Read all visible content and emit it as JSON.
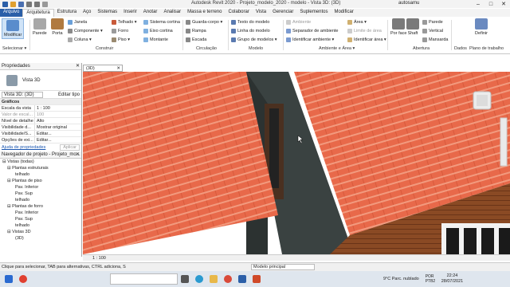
{
  "titlebar": {
    "title": "Autodesk Revit 2020 - Projeto_modelo_2020 - modelo - Vista 3D: (3D)",
    "user": "autosamu"
  },
  "tabs": [
    "Arquivo",
    "Arquitetura",
    "Estrutura",
    "Aço",
    "Sistemas",
    "Inserir",
    "Anotar",
    "Analisar",
    "Massa e terreno",
    "Colaborar",
    "Vista",
    "Gerenciar",
    "Suplementos",
    "Modificar"
  ],
  "ribbon": {
    "modificar": "Modificar",
    "selecionar": "Selecionar ▾",
    "construir": {
      "parede": "Parede",
      "porta": "Porta",
      "janela": "Janela",
      "componente": "Componente ▾",
      "coluna": "Coluna ▾",
      "telhado": "Telhado ▾",
      "forro": "Forro",
      "piso": "Piso ▾",
      "sistema_cortina": "Sistema cortina",
      "eixo_cortina": "Eixo cortina",
      "montante": "Montante",
      "label": "Construir"
    },
    "circulacao": {
      "guarda_corpo": "Guarda-corpo ▾",
      "rampa": "Rampa",
      "escada": "Escada",
      "label": "Circulação"
    },
    "modelo": {
      "texto": "Texto do modelo",
      "linha": "Linha do modelo",
      "grupo": "Grupo de modelos ▾",
      "label": "Modelo"
    },
    "ambiente": {
      "ambiente": "Ambiente",
      "separador": "Separador de ambiente",
      "identificar": "Identificar ambiente ▾",
      "area": "Área ▾",
      "limite": "Limite de área",
      "identificar_area": "Identificar área ▾",
      "label": "Ambiente e Área ▾"
    },
    "abertura": {
      "por_face": "Por face",
      "shaft": "Shaft",
      "parede": "Parede",
      "vertical": "Vertical",
      "mansarda": "Mansarda",
      "label": "Abertura"
    },
    "dados": {
      "label": "Dados"
    },
    "plano": {
      "definir": "Definir",
      "label": "Plano de trabalho"
    }
  },
  "properties": {
    "header": "Propriedades",
    "type": "Vista 3D",
    "selector": "Vista 3D: (3D)",
    "edit_type": "Editar tipo",
    "section": "Gráficos",
    "rows": [
      {
        "k": "Escala da vista",
        "v": "1 : 100"
      },
      {
        "k": "Valor de escal...",
        "v": "100"
      },
      {
        "k": "Nível de detalhe",
        "v": "Alto"
      },
      {
        "k": "Visibilidade d...",
        "v": "Mostrar original"
      },
      {
        "k": "Visibilidade/S...",
        "v": "Editar..."
      },
      {
        "k": "Opções de exi...",
        "v": "Editar..."
      }
    ],
    "help": "Ajuda de propriedades",
    "apply": "Aplicar"
  },
  "browser": {
    "header": "Navegador de projeto - Projeto_mo...",
    "items": [
      {
        "t": "⊟ Vistas (todas)",
        "lvl": 0
      },
      {
        "t": "⊟ Plantas estruturais",
        "lvl": 1
      },
      {
        "t": "telhado",
        "lvl": 2
      },
      {
        "t": "⊟ Plantas de piso",
        "lvl": 1
      },
      {
        "t": "Pav. Inferior",
        "lvl": 2
      },
      {
        "t": "Pav. Sup",
        "lvl": 2
      },
      {
        "t": "telhado",
        "lvl": 2
      },
      {
        "t": "⊟ Plantas de forro",
        "lvl": 1
      },
      {
        "t": "Pav. Inferior",
        "lvl": 2
      },
      {
        "t": "Pav. Sup",
        "lvl": 2
      },
      {
        "t": "telhado",
        "lvl": 2
      },
      {
        "t": "⊟ Vistas 3D",
        "lvl": 1
      },
      {
        "t": "(3D)",
        "lvl": 2
      }
    ]
  },
  "view": {
    "tab": "(3D)",
    "scale": "1 : 100"
  },
  "status": {
    "text": "Clique para selecionar, TAB para alternativas, CTRL adiciona, S",
    "model": "Modelo principal"
  },
  "taskbar": {
    "weather": "9°C  Parc. nublado",
    "lang": "POR PTB2",
    "time": "22:24",
    "date": "28/07/2021"
  },
  "colors": {
    "file_tab": "#2b5fa8",
    "roof": "#e8694a",
    "wall": "#3a4241",
    "brick": "#8a4a24"
  }
}
